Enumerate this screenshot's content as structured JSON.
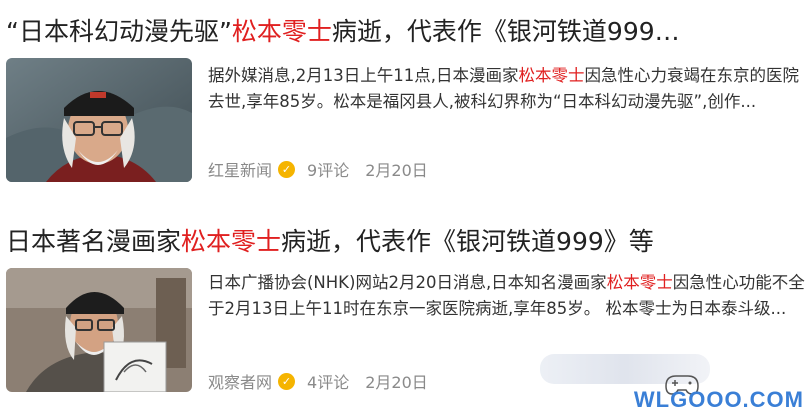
{
  "results": [
    {
      "title_pre": "“日本科幻动漫先驱”",
      "title_hl": "松本零士",
      "title_post": "病逝，代表作《银河铁道999…",
      "snippet_pre": "据外媒消息,2月13日上午11点,日本漫画家",
      "snippet_hl": "松本零士",
      "snippet_post": "因急性心力衰竭在东京的医院去世,享年85岁。松本是福冈县人,被科幻界称为“日本科幻动漫先驱”,创作...",
      "source": "红星新闻",
      "comments": "9评论",
      "date": "2月20日"
    },
    {
      "title_pre": "日本著名漫画家",
      "title_hl": "松本零士",
      "title_post": "病逝，代表作《银河铁道999》等",
      "snippet_pre": "日本广播协会(NHK)网站2月20日消息,日本知名漫画家",
      "snippet_hl": "松本零士",
      "snippet_post": "因急性心功能不全于2月13日上午11时在东京一家医院病逝,享年85岁。 松本零士为日本泰斗级...",
      "source": "观察者网",
      "comments": "4评论",
      "date": "2月20日"
    }
  ],
  "watermark": "WLGOOO.COM",
  "colors": {
    "highlight": "#e02020",
    "meta": "#8a8a8a",
    "badge": "#f5b400"
  }
}
